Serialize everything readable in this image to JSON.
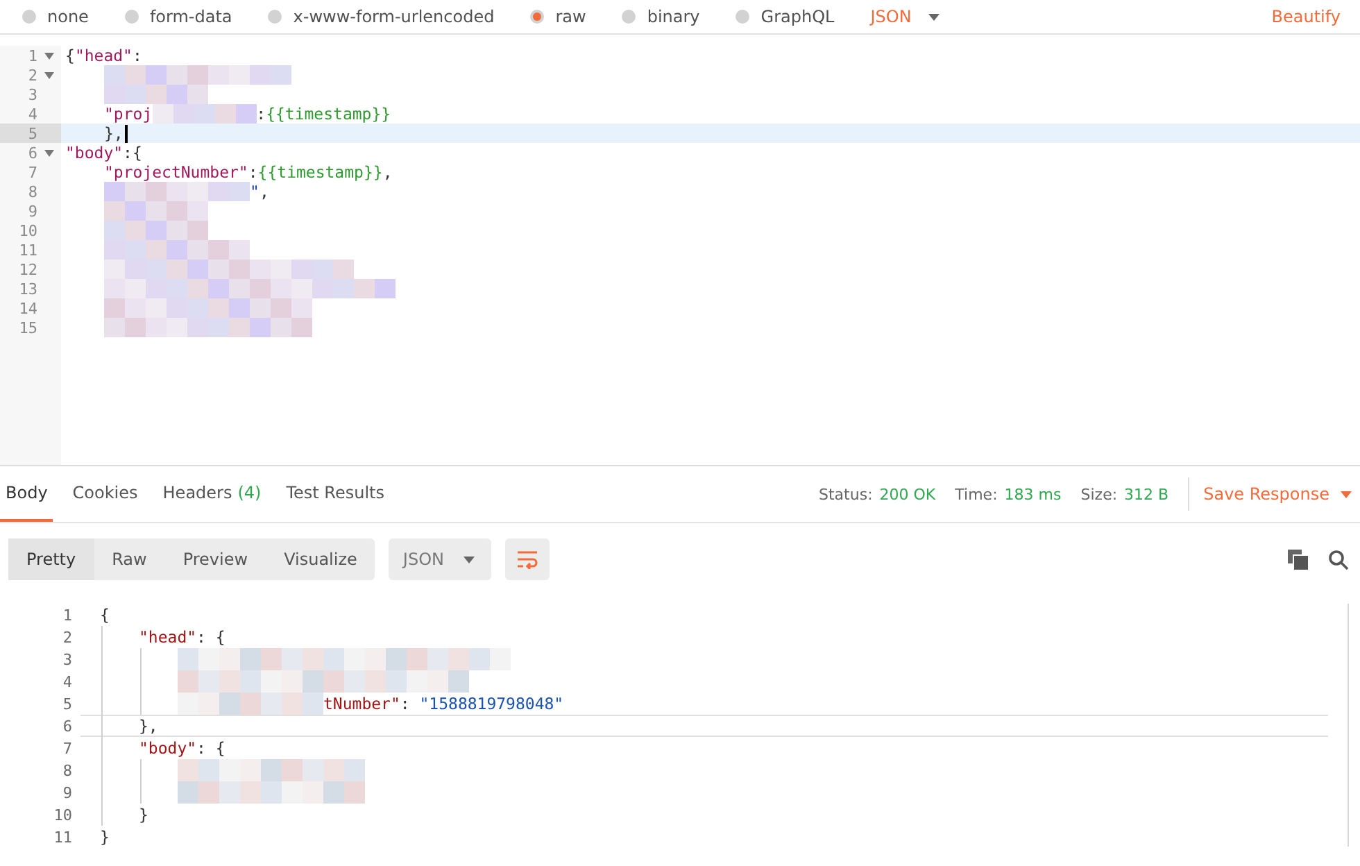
{
  "body_types": [
    {
      "label": "none",
      "selected": false
    },
    {
      "label": "form-data",
      "selected": false
    },
    {
      "label": "x-www-form-urlencoded",
      "selected": false
    },
    {
      "label": "raw",
      "selected": true
    },
    {
      "label": "binary",
      "selected": false
    },
    {
      "label": "GraphQL",
      "selected": false
    }
  ],
  "format_select": {
    "value": "JSON"
  },
  "beautify": "Beautify",
  "editor": {
    "lines": [
      {
        "number": "1",
        "foldable": true,
        "active": false,
        "parts": [
          {
            "kind": "punct",
            "t": "{"
          },
          {
            "kind": "key",
            "t": "\"head\""
          },
          {
            "kind": "punct",
            "t": ":"
          }
        ]
      },
      {
        "number": "2",
        "foldable": true,
        "active": false,
        "parts": [
          {
            "kind": "redacted"
          }
        ]
      },
      {
        "number": "3",
        "foldable": false,
        "active": false,
        "parts": [
          {
            "kind": "redacted"
          }
        ]
      },
      {
        "number": "4",
        "foldable": false,
        "active": false,
        "parts": [
          {
            "kind": "key",
            "t": "\"proj"
          },
          {
            "kind": "redacted"
          },
          {
            "kind": "punct",
            "t": ":"
          },
          {
            "kind": "var",
            "t": "{{timestamp}}"
          }
        ]
      },
      {
        "number": "5",
        "foldable": false,
        "active": true,
        "parts": [
          {
            "kind": "punct",
            "t": "},"
          }
        ]
      },
      {
        "number": "6",
        "foldable": true,
        "active": false,
        "parts": [
          {
            "kind": "key",
            "t": "\"body\""
          },
          {
            "kind": "punct",
            "t": ":{"
          }
        ]
      },
      {
        "number": "7",
        "foldable": false,
        "active": false,
        "parts": [
          {
            "kind": "key",
            "t": "\"projectNumber\""
          },
          {
            "kind": "punct",
            "t": ":"
          },
          {
            "kind": "var",
            "t": "{{timestamp}}"
          },
          {
            "kind": "punct",
            "t": ","
          }
        ]
      },
      {
        "number": "8",
        "foldable": false,
        "active": false,
        "parts": [
          {
            "kind": "redacted"
          },
          {
            "kind": "str",
            "t": "\""
          },
          {
            "kind": "punct",
            "t": ","
          }
        ]
      },
      {
        "number": "9",
        "foldable": false,
        "active": false,
        "parts": [
          {
            "kind": "redacted"
          }
        ]
      },
      {
        "number": "10",
        "foldable": false,
        "active": false,
        "parts": [
          {
            "kind": "redacted"
          }
        ]
      },
      {
        "number": "11",
        "foldable": false,
        "active": false,
        "parts": [
          {
            "kind": "redacted"
          }
        ]
      },
      {
        "number": "12",
        "foldable": false,
        "active": false,
        "parts": [
          {
            "kind": "redacted"
          }
        ]
      },
      {
        "number": "13",
        "foldable": false,
        "active": false,
        "parts": [
          {
            "kind": "redacted"
          }
        ]
      },
      {
        "number": "14",
        "foldable": false,
        "active": false,
        "parts": [
          {
            "kind": "redacted"
          }
        ]
      },
      {
        "number": "15",
        "foldable": false,
        "active": false,
        "parts": [
          {
            "kind": "redacted"
          }
        ]
      }
    ]
  },
  "response_tabs": [
    {
      "label": "Body",
      "selected": true
    },
    {
      "label": "Cookies",
      "selected": false
    },
    {
      "label": "Headers",
      "count": "(4)",
      "selected": false
    },
    {
      "label": "Test Results",
      "selected": false
    }
  ],
  "status": [
    {
      "label": "Status:",
      "value": "200 OK"
    },
    {
      "label": "Time:",
      "value": "183 ms"
    },
    {
      "label": "Size:",
      "value": "312 B"
    }
  ],
  "save_response": "Save Response",
  "view_modes": [
    {
      "label": "Pretty",
      "selected": true
    },
    {
      "label": "Raw",
      "selected": false
    },
    {
      "label": "Preview",
      "selected": false
    },
    {
      "label": "Visualize",
      "selected": false
    }
  ],
  "response_format": {
    "value": "JSON"
  },
  "wrap_lines": {
    "on": true
  },
  "response": {
    "lines": [
      {
        "number": "1",
        "active": false,
        "parts": [
          {
            "kind": "punct",
            "t": "{"
          }
        ]
      },
      {
        "number": "2",
        "active": false,
        "parts": [
          {
            "kind": "key",
            "t": "\"head\""
          },
          {
            "kind": "punct",
            "t": ": {"
          }
        ]
      },
      {
        "number": "3",
        "active": false,
        "parts": [
          {
            "kind": "redacted"
          }
        ]
      },
      {
        "number": "4",
        "active": false,
        "parts": [
          {
            "kind": "redacted"
          }
        ]
      },
      {
        "number": "5",
        "active": false,
        "parts": [
          {
            "kind": "redacted"
          },
          {
            "kind": "key",
            "t": "tNumber\""
          },
          {
            "kind": "punct",
            "t": ": "
          },
          {
            "kind": "str",
            "t": "\"1588819798048\""
          }
        ]
      },
      {
        "number": "6",
        "active": true,
        "parts": [
          {
            "kind": "punct",
            "t": "},"
          }
        ]
      },
      {
        "number": "7",
        "active": false,
        "parts": [
          {
            "kind": "key",
            "t": "\"body\""
          },
          {
            "kind": "punct",
            "t": ": {"
          }
        ]
      },
      {
        "number": "8",
        "active": false,
        "parts": [
          {
            "kind": "redacted"
          }
        ]
      },
      {
        "number": "9",
        "active": false,
        "parts": [
          {
            "kind": "redacted"
          }
        ]
      },
      {
        "number": "10",
        "active": false,
        "parts": [
          {
            "kind": "punct",
            "t": "}"
          }
        ]
      },
      {
        "number": "11",
        "active": false,
        "parts": [
          {
            "kind": "punct",
            "t": "}"
          }
        ]
      }
    ]
  }
}
